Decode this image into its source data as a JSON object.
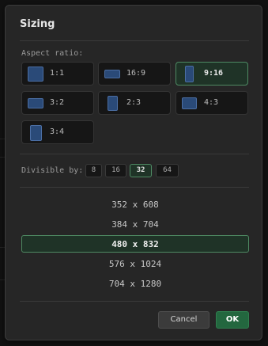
{
  "dialog": {
    "title": "Sizing"
  },
  "aspect": {
    "label": "Aspect ratio:",
    "options": [
      {
        "label": "1:1",
        "selected": false,
        "icon": "square-ratio-icon"
      },
      {
        "label": "16:9",
        "selected": false,
        "icon": "landscape-wide-ratio-icon"
      },
      {
        "label": "9:16",
        "selected": true,
        "icon": "portrait-tall-ratio-icon"
      },
      {
        "label": "3:2",
        "selected": false,
        "icon": "landscape-ratio-icon"
      },
      {
        "label": "2:3",
        "selected": false,
        "icon": "portrait-ratio-icon"
      },
      {
        "label": "4:3",
        "selected": false,
        "icon": "landscape-ratio-icon"
      },
      {
        "label": "3:4",
        "selected": false,
        "icon": "portrait-ratio-icon"
      }
    ]
  },
  "divisible": {
    "label": "Divisible by:",
    "options": [
      "8",
      "16",
      "32",
      "64"
    ],
    "selected": "32"
  },
  "sizes": {
    "options": [
      "352 x 608",
      "384 x 704",
      "480 x 832",
      "576 x 1024",
      "704 x 1280"
    ],
    "selected": "480 x 832"
  },
  "buttons": {
    "cancel": "Cancel",
    "ok": "OK"
  },
  "colors": {
    "accent_green": "#4e8a63",
    "ok_button": "#23673f",
    "ratio_icon_blue": "#2a4a78"
  }
}
